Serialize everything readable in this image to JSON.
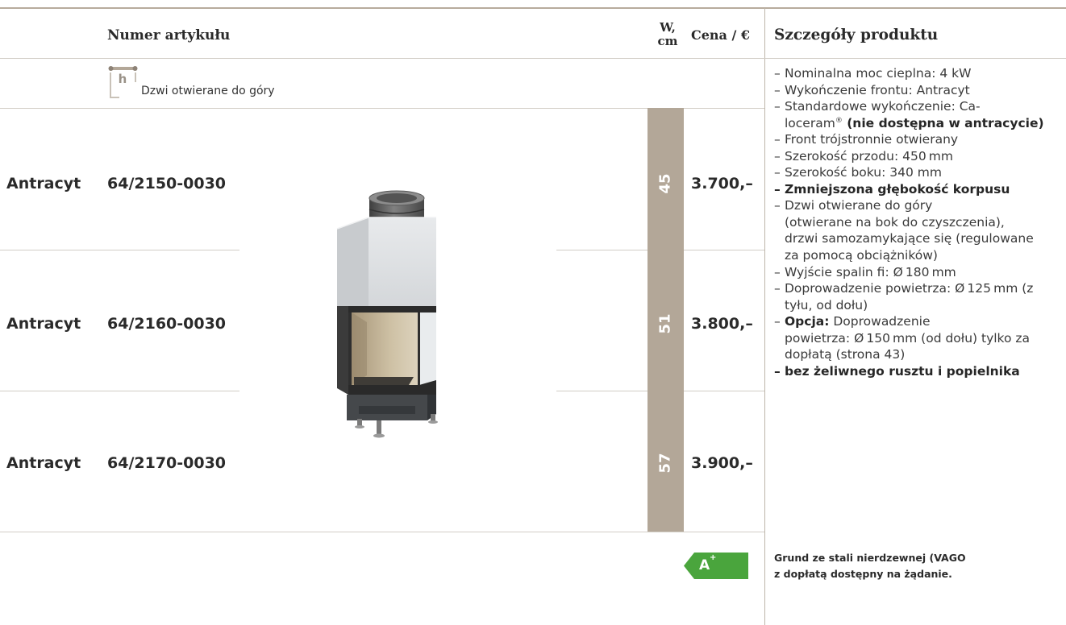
{
  "header": {
    "article_number": "Numer artykułu",
    "width_line1": "W,",
    "width_line2": "cm",
    "price": "Cena / €",
    "details_title": "Szczegóły produktu"
  },
  "door_type": {
    "icon": "door-opens-upward-icon",
    "icon_letter": "h",
    "label": "Dzwi otwierane do góry"
  },
  "rows": [
    {
      "finish": "Antracyt",
      "article": "64/2150-0030",
      "width_cm": "45",
      "price": "3.700,–"
    },
    {
      "finish": "Antracyt",
      "article": "64/2160-0030",
      "width_cm": "51",
      "price": "3.800,–"
    },
    {
      "finish": "Antracyt",
      "article": "64/2170-0030",
      "width_cm": "57",
      "price": "3.900,–"
    }
  ],
  "details": {
    "lines": [
      {
        "d": "–",
        "t": "Nominalna moc cieplna: 4 kW"
      },
      {
        "d": "–",
        "t": "Wykończenie frontu: Antracyt"
      },
      {
        "d": "–",
        "t": "Standardowe wykończenie: Ca-"
      },
      {
        "t": "loceram",
        "sup": "®",
        "b": " (nie dostępna w antracycie)"
      },
      {
        "d": "–",
        "t": "Front trójstronnie otwierany"
      },
      {
        "d": "–",
        "t": "Szerokość przodu: 450 mm"
      },
      {
        "d": "–",
        "t": "Szerokość boku: 340 mm"
      },
      {
        "d": "–",
        "b": "Zmniejszona głębokość korpusu"
      },
      {
        "d": "–",
        "t": "Dzwi otwierane do góry"
      },
      {
        "t": "(otwierane na bok do czyszczenia),"
      },
      {
        "t": "drzwi samozamykające się (regulowane"
      },
      {
        "t": "za pomocą obciążników)"
      },
      {
        "d": "–",
        "t": "Wyjście spalin fi: Ø 180 mm"
      },
      {
        "d": "–",
        "t": "Doprowadzenie powietrza: Ø 125 mm (z"
      },
      {
        "t": "tyłu, od dołu)"
      },
      {
        "d": "–",
        "b": "Opcja:",
        "t": " Doprowadzenie"
      },
      {
        "t": "powietrza: Ø 150 mm (od dołu) tylko za"
      },
      {
        "t": "dopłatą (strona 43)"
      },
      {
        "d": "–",
        "b": "bez żeliwnego rusztu i popielnika"
      }
    ]
  },
  "energy_label": {
    "class": "A",
    "plus": "+",
    "color": "#4aa53d"
  },
  "note": {
    "line1": "Grund ze stali nierdzewnej (VAGO",
    "line2": "z dopłatą dostępny na żądanie."
  },
  "colors": {
    "width_bar": "#b3a798",
    "top_rule": "#b7ab9d",
    "energy_green": "#4aa53d"
  }
}
